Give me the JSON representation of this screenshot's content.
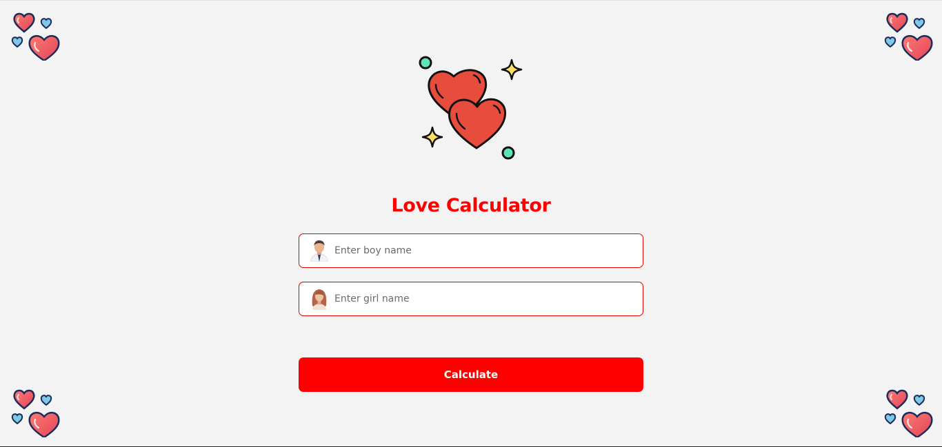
{
  "app": {
    "title": "Love Calculator"
  },
  "form": {
    "boy_input": {
      "placeholder": "Enter boy name",
      "value": "",
      "icon": "boy-avatar-icon"
    },
    "girl_input": {
      "placeholder": "Enter girl name",
      "value": "",
      "icon": "girl-avatar-icon"
    },
    "submit_label": "Calculate"
  },
  "decorations": {
    "logo_icon": "two-hearts-sparkles-icon",
    "corner_icon": "hearts-cluster-icon"
  },
  "colors": {
    "accent": "#ff0000",
    "heart_red": "#e84c3d",
    "heart_outline": "#1b2b5b",
    "heart_blue": "#7fc9e6",
    "background": "#f3f3f3",
    "sparkle": "#ffe066",
    "dot": "#5fe3b6"
  }
}
